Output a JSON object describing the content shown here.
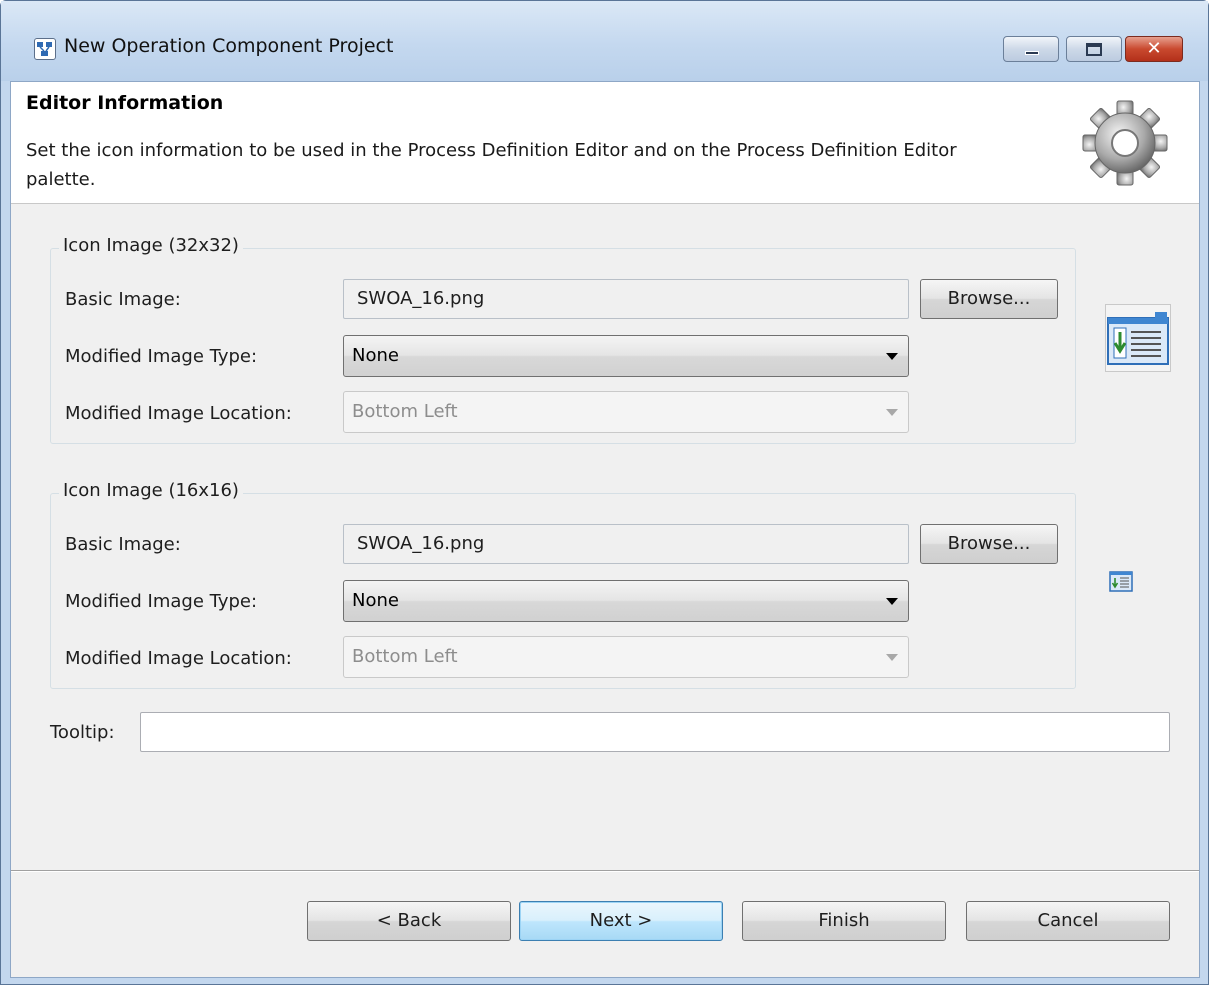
{
  "window": {
    "title": "New Operation Component Project",
    "close_glyph": "✕",
    "icons": {
      "app": "project-wizard-icon",
      "minimize": "minimize-icon",
      "maximize": "maximize-icon",
      "close": "close-icon"
    }
  },
  "header": {
    "title": "Editor Information",
    "description": "Set the icon information to be used in the Process Definition Editor and on the Process Definition Editor palette.",
    "icon": "gear-icon"
  },
  "icon32": {
    "legend": "Icon Image (32x32)",
    "basic_image_label": "Basic Image:",
    "basic_image_value": "SWOA_16.png",
    "browse_label": "Browse...",
    "modified_type_label": "Modified Image Type:",
    "modified_type_value": "None",
    "modified_location_label": "Modified Image Location:",
    "modified_location_value": "Bottom Left",
    "preview_icon": "component-preview-large-icon"
  },
  "icon16": {
    "legend": "Icon Image (16x16)",
    "basic_image_label": "Basic Image:",
    "basic_image_value": "SWOA_16.png",
    "browse_label": "Browse...",
    "modified_type_label": "Modified Image Type:",
    "modified_type_value": "None",
    "modified_location_label": "Modified Image Location:",
    "modified_location_value": "Bottom Left",
    "preview_icon": "component-preview-small-icon"
  },
  "tooltip": {
    "label": "Tooltip:",
    "value": ""
  },
  "footer": {
    "back": "< Back",
    "next": "Next >",
    "finish": "Finish",
    "cancel": "Cancel"
  },
  "colors": {
    "frame": "#c3d7ee",
    "dialog_bg": "#f0f0f0",
    "header_bg": "#ffffff",
    "default_button_border": "#3c7fb1",
    "close_button": "#c9492f"
  }
}
